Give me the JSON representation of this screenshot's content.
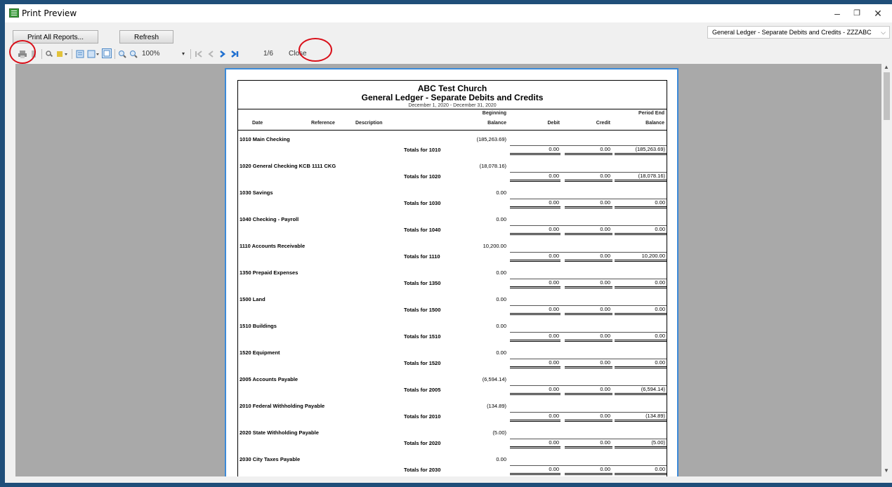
{
  "window": {
    "title": "Print Preview",
    "minimize": "–",
    "restore": "❐",
    "close": "✕"
  },
  "toolbar": {
    "print_all_label": "Print All Reports...",
    "refresh_label": "Refresh",
    "zoom": "100%",
    "page_indicator": "1/6",
    "close_label": "Close",
    "report_select": "General Ledger - Separate Debits and Credits - ZZZABC"
  },
  "report": {
    "org": "ABC Test Church",
    "title": "General Ledger - Separate Debits and Credits",
    "date_range": "December 1, 2020 - December 31, 2020",
    "columns": {
      "date": "Date",
      "reference": "Reference",
      "description": "Description",
      "beginning_1": "Beginning",
      "beginning_2": "Balance",
      "debit": "Debit",
      "credit": "Credit",
      "period_end_1": "Period End",
      "period_end_2": "Balance"
    },
    "accounts": [
      {
        "name": "1010  Main Checking",
        "beginning": "(185,263.69)",
        "total_label": "Totals for 1010",
        "debit": "0.00",
        "credit": "0.00",
        "end": "(185,263.69)"
      },
      {
        "name": "1020  General Checking KCB 1111 CKG",
        "beginning": "(18,078.16)",
        "total_label": "Totals for 1020",
        "debit": "0.00",
        "credit": "0.00",
        "end": "(18,078.16)"
      },
      {
        "name": "1030  Savings",
        "beginning": "0.00",
        "total_label": "Totals for 1030",
        "debit": "0.00",
        "credit": "0.00",
        "end": "0.00"
      },
      {
        "name": "1040  Checking - Payroll",
        "beginning": "0.00",
        "total_label": "Totals for 1040",
        "debit": "0.00",
        "credit": "0.00",
        "end": "0.00"
      },
      {
        "name": "1110  Accounts Receivable",
        "beginning": "10,200.00",
        "total_label": "Totals for 1110",
        "debit": "0.00",
        "credit": "0.00",
        "end": "10,200.00"
      },
      {
        "name": "1350  Prepaid Expenses",
        "beginning": "0.00",
        "total_label": "Totals for 1350",
        "debit": "0.00",
        "credit": "0.00",
        "end": "0.00"
      },
      {
        "name": "1500  Land",
        "beginning": "0.00",
        "total_label": "Totals for 1500",
        "debit": "0.00",
        "credit": "0.00",
        "end": "0.00"
      },
      {
        "name": "1510  Buildings",
        "beginning": "0.00",
        "total_label": "Totals for 1510",
        "debit": "0.00",
        "credit": "0.00",
        "end": "0.00"
      },
      {
        "name": "1520  Equipment",
        "beginning": "0.00",
        "total_label": "Totals for 1520",
        "debit": "0.00",
        "credit": "0.00",
        "end": "0.00"
      },
      {
        "name": "2005  Accounts Payable",
        "beginning": "(6,594.14)",
        "total_label": "Totals for 2005",
        "debit": "0.00",
        "credit": "0.00",
        "end": "(6,594.14)"
      },
      {
        "name": "2010  Federal Withholding Payable",
        "beginning": "(134.89)",
        "total_label": "Totals for 2010",
        "debit": "0.00",
        "credit": "0.00",
        "end": "(134.89)"
      },
      {
        "name": "2020  State Withholding Payable",
        "beginning": "(5.00)",
        "total_label": "Totals for 2020",
        "debit": "0.00",
        "credit": "0.00",
        "end": "(5.00)"
      },
      {
        "name": "2030  City Taxes Payable",
        "beginning": "0.00",
        "total_label": "Totals for 2030",
        "debit": "0.00",
        "credit": "0.00",
        "end": "0.00"
      }
    ]
  }
}
